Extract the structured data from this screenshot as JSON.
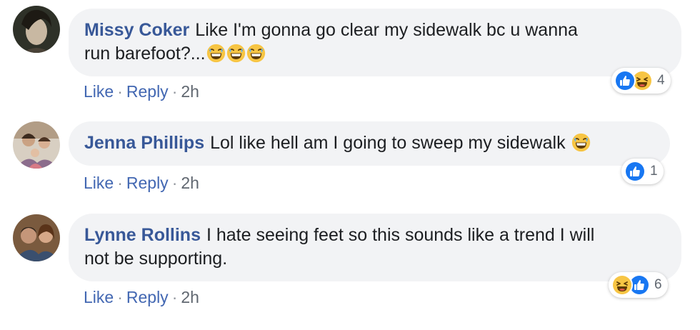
{
  "comments": [
    {
      "author": "Missy Coker",
      "text_line1": "Like I'm gonna go clear my sidewalk bc u wanna",
      "text_line2": "run barefoot?...",
      "actions": {
        "like": "Like",
        "reply": "Reply",
        "time": "2h"
      },
      "reactions": {
        "icons": [
          "like-reaction-icon",
          "haha-reaction-icon"
        ],
        "count": "4"
      }
    },
    {
      "author": "Jenna Phillips",
      "text_line1": "Lol like hell am I going to sweep my sidewalk",
      "actions": {
        "like": "Like",
        "reply": "Reply",
        "time": "2h"
      },
      "reactions": {
        "icons": [
          "like-reaction-icon"
        ],
        "count": "1"
      }
    },
    {
      "author": "Lynne Rollins",
      "text_line1": "I hate seeing feet so this sounds like a trend I will",
      "text_line2": "not be supporting.",
      "actions": {
        "like": "Like",
        "reply": "Reply",
        "time": "2h"
      },
      "reactions": {
        "icons": [
          "haha-reaction-icon",
          "like-reaction-icon"
        ],
        "count": "6"
      }
    }
  ],
  "separator": "·",
  "colors": {
    "author": "#385898",
    "link": "#4267b2",
    "bubble": "#f2f3f5",
    "like_blue": "#1877f2",
    "haha_yellow": "#f7c544"
  }
}
